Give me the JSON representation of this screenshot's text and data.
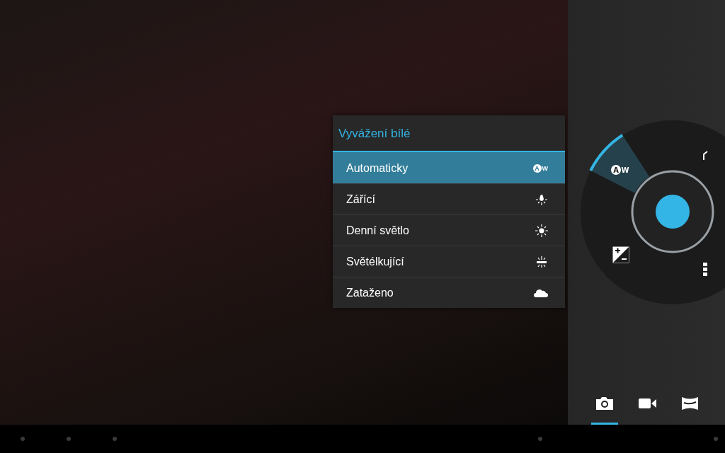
{
  "menu": {
    "title": "Vyvážení bílé",
    "options": [
      {
        "label": "Automaticky",
        "kind": "auto",
        "glyph": "A",
        "glyph_suffix": "W",
        "selected": true
      },
      {
        "label": "Zářící",
        "kind": "incandescent",
        "selected": false
      },
      {
        "label": "Denní světlo",
        "kind": "daylight",
        "selected": false
      },
      {
        "label": "Světélkující",
        "kind": "fluorescent",
        "selected": false
      },
      {
        "label": "Zataženo",
        "kind": "cloudy",
        "selected": false
      }
    ]
  },
  "dial": {
    "current": {
      "glyph": "A",
      "glyph_suffix": "W"
    }
  },
  "modes": [
    {
      "kind": "photo",
      "selected": true
    },
    {
      "kind": "video",
      "selected": false
    },
    {
      "kind": "panorama",
      "selected": false
    }
  ]
}
